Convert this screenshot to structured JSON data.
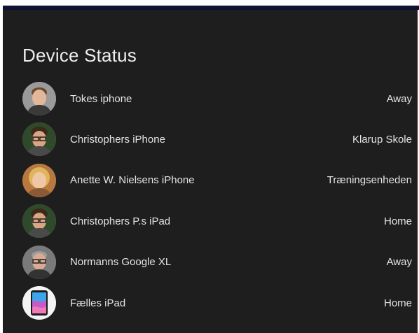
{
  "card": {
    "title": "Device Status"
  },
  "devices": [
    {
      "name": "Tokes iphone",
      "state": "Away",
      "avatar_icon": "person-avatar-icon"
    },
    {
      "name": "Christophers iPhone",
      "state": "Klarup Skole",
      "avatar_icon": "person-avatar-icon"
    },
    {
      "name": "Anette W. Nielsens iPhone",
      "state": "Træningsenheden",
      "avatar_icon": "person-avatar-icon"
    },
    {
      "name": "Christophers P.s iPad",
      "state": "Home",
      "avatar_icon": "person-avatar-icon"
    },
    {
      "name": "Normanns Google XL",
      "state": "Away",
      "avatar_icon": "person-avatar-icon"
    },
    {
      "name": "Fælles iPad",
      "state": "Home",
      "avatar_icon": "ipad-icon"
    }
  ],
  "colors": {
    "card_background": "#1e1e1e",
    "text": "#e4e4e4",
    "top_bar": "#0d1330"
  }
}
